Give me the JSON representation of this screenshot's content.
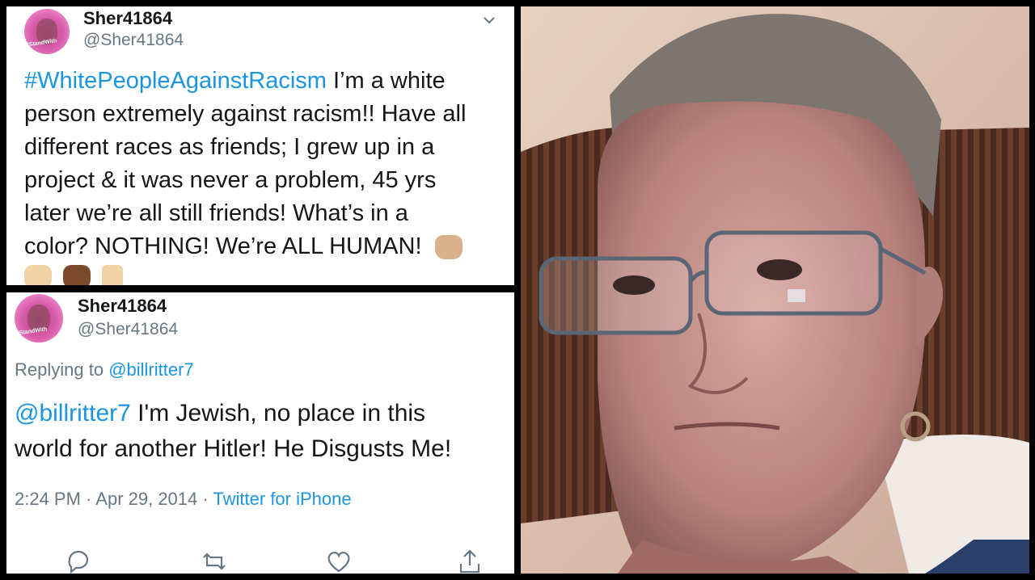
{
  "tweet1": {
    "name": "Sher41864",
    "handle": "@Sher41864",
    "avatar_tag": "#StandWith",
    "hashtag": "#WhitePeopleAgainstRacism",
    "text_line1": " I’m a white",
    "text_line2": "person extremely against racism!! Have all",
    "text_line3": "different races as friends; I grew up in a",
    "text_line4": "project & it was never a problem, 45 yrs",
    "text_line5": "later we’re all still friends! What’s in a",
    "text_line6": "color? NOTHING! We’re ALL HUMAN!",
    "emojis": [
      "raised-fist-medium-light",
      "raised-fist-light",
      "raised-fist-dark",
      "victory-hand-light"
    ]
  },
  "tweet2": {
    "name": "Sher41864",
    "handle": "@Sher41864",
    "avatar_tag": "#StandWith",
    "replying_label": "Replying to ",
    "replying_to": "@billritter7",
    "mention": "@billritter7",
    "text_line1": " I'm Jewish, no place in this",
    "text_line2": "world for another Hitler! He Disgusts Me!",
    "time": "2:24 PM",
    "separator": " · ",
    "date": "Apr 29, 2014",
    "source": "Twitter for iPhone",
    "actions": [
      "reply-icon",
      "retweet-icon",
      "like-icon",
      "share-icon"
    ]
  },
  "photo": {
    "subject": "selfie-photo"
  }
}
